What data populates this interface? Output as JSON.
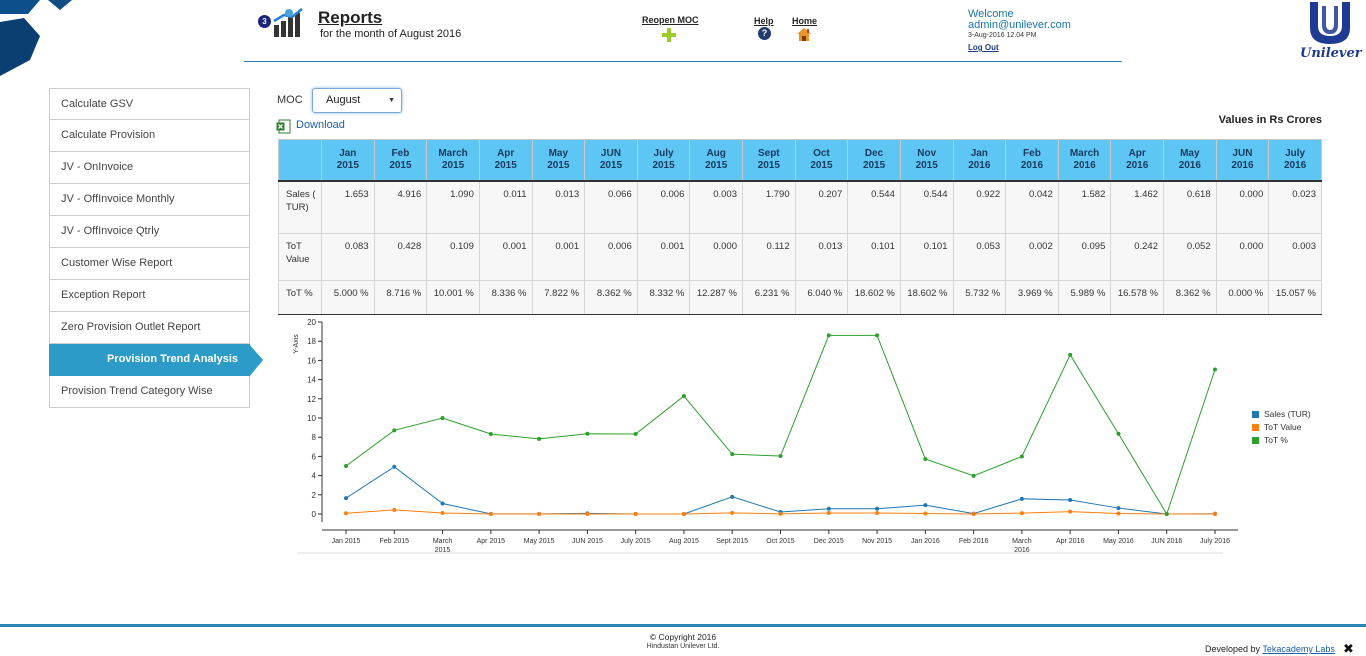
{
  "header": {
    "badge": "3",
    "title": "Reports",
    "subtitle": "for the month of August 2016",
    "reopen_label": "Reopen MOC",
    "help_label": "Help",
    "help_glyph": "?",
    "home_label": "Home",
    "welcome": "Welcome",
    "email": "admin@unilever.com",
    "datetime": "3-Aug-2016 12.04 PM",
    "logout": "Log Out",
    "logo_text": "Unilever"
  },
  "sidebar": {
    "items": [
      {
        "label": "Calculate GSV"
      },
      {
        "label": "Calculate Provision"
      },
      {
        "label": "JV - OnInvoice"
      },
      {
        "label": "JV - OffInvoice Monthly"
      },
      {
        "label": "JV - OffInvoice Qtrly"
      },
      {
        "label": "Customer Wise Report"
      },
      {
        "label": "Exception Report"
      },
      {
        "label": "Zero Provision Outlet Report"
      },
      {
        "label": "Provision Trend Analysis"
      },
      {
        "label": "Provision Trend Category Wise"
      }
    ],
    "active_index": 8
  },
  "controls": {
    "moc_label": "MOC",
    "moc_value": "August",
    "caret": "▼",
    "download_label": "Download",
    "values_note": "Values in Rs Crores"
  },
  "table": {
    "headers": [
      "Jan\n2015",
      "Feb\n2015",
      "March\n2015",
      "Apr\n2015",
      "May\n2015",
      "JUN\n2015",
      "July\n2015",
      "Aug\n2015",
      "Sept\n2015",
      "Oct\n2015",
      "Dec\n2015",
      "Nov\n2015",
      "Jan\n2016",
      "Feb\n2016",
      "March\n2016",
      "Apr\n2016",
      "May\n2016",
      "JUN\n2016",
      "July\n2016"
    ],
    "rows": [
      {
        "label": "Sales ( TUR)",
        "values": [
          "1.653",
          "4.916",
          "1.090",
          "0.011",
          "0.013",
          "0.066",
          "0.006",
          "0.003",
          "1.790",
          "0.207",
          "0.544",
          "0.544",
          "0.922",
          "0.042",
          "1.582",
          "1.462",
          "0.618",
          "0.000",
          "0.023"
        ]
      },
      {
        "label": "ToT Value",
        "values": [
          "0.083",
          "0.428",
          "0.109",
          "0.001",
          "0.001",
          "0.006",
          "0.001",
          "0.000",
          "0.112",
          "0.013",
          "0.101",
          "0.101",
          "0.053",
          "0.002",
          "0.095",
          "0.242",
          "0.052",
          "0.000",
          "0.003"
        ]
      },
      {
        "label": "ToT %",
        "values": [
          "5.000 %",
          "8.716 %",
          "10.001 %",
          "8.336 %",
          "7.822 %",
          "8.362 %",
          "8.332 %",
          "12.287 %",
          "6.231 %",
          "6.040 %",
          "18.602 %",
          "18.602 %",
          "5.732 %",
          "3.969 %",
          "5.989 %",
          "16.578 %",
          "8.362 %",
          "0.000 %",
          "15.057 %"
        ]
      }
    ]
  },
  "chart_data": {
    "type": "line",
    "ylabel": "Y-Axis",
    "xlabel": "",
    "ylim": [
      0,
      20
    ],
    "yticks": [
      0,
      2,
      4,
      6,
      8,
      10,
      12,
      14,
      16,
      18,
      20
    ],
    "categories": [
      "Jan 2015",
      "Feb 2015",
      "March 2015",
      "Apr 2015",
      "May 2015",
      "JUN 2015",
      "July 2015",
      "Aug 2015",
      "Sept 2015",
      "Oct 2015",
      "Dec 2015",
      "Nov 2015",
      "Jan 2016",
      "Feb 2016",
      "March 2016",
      "Apr 2016",
      "May 2016",
      "JUN 2016",
      "July 2016"
    ],
    "legend_position": "right",
    "series": [
      {
        "name": "Sales (TUR)",
        "color": "#1f77b4",
        "values": [
          1.653,
          4.916,
          1.09,
          0.011,
          0.013,
          0.066,
          0.006,
          0.003,
          1.79,
          0.207,
          0.544,
          0.544,
          0.922,
          0.042,
          1.582,
          1.462,
          0.618,
          0.0,
          0.023
        ]
      },
      {
        "name": "ToT Value",
        "color": "#ff7f0e",
        "values": [
          0.083,
          0.428,
          0.109,
          0.001,
          0.001,
          0.006,
          0.001,
          0.0,
          0.112,
          0.013,
          0.101,
          0.101,
          0.053,
          0.002,
          0.095,
          0.242,
          0.052,
          0.0,
          0.003
        ]
      },
      {
        "name": "ToT %",
        "color": "#2ca02c",
        "values": [
          5.0,
          8.716,
          10.001,
          8.336,
          7.822,
          8.362,
          8.332,
          12.287,
          6.231,
          6.04,
          18.602,
          18.602,
          5.732,
          3.969,
          5.989,
          16.578,
          8.362,
          0.0,
          15.057
        ]
      }
    ]
  },
  "footer": {
    "copyright": "© Copyright 2016",
    "company": "Hindustan Unilever Ltd.",
    "developed_by": "Developed by ",
    "dev_link": "Tekacademy Labs",
    "close_glyph": "✖"
  }
}
